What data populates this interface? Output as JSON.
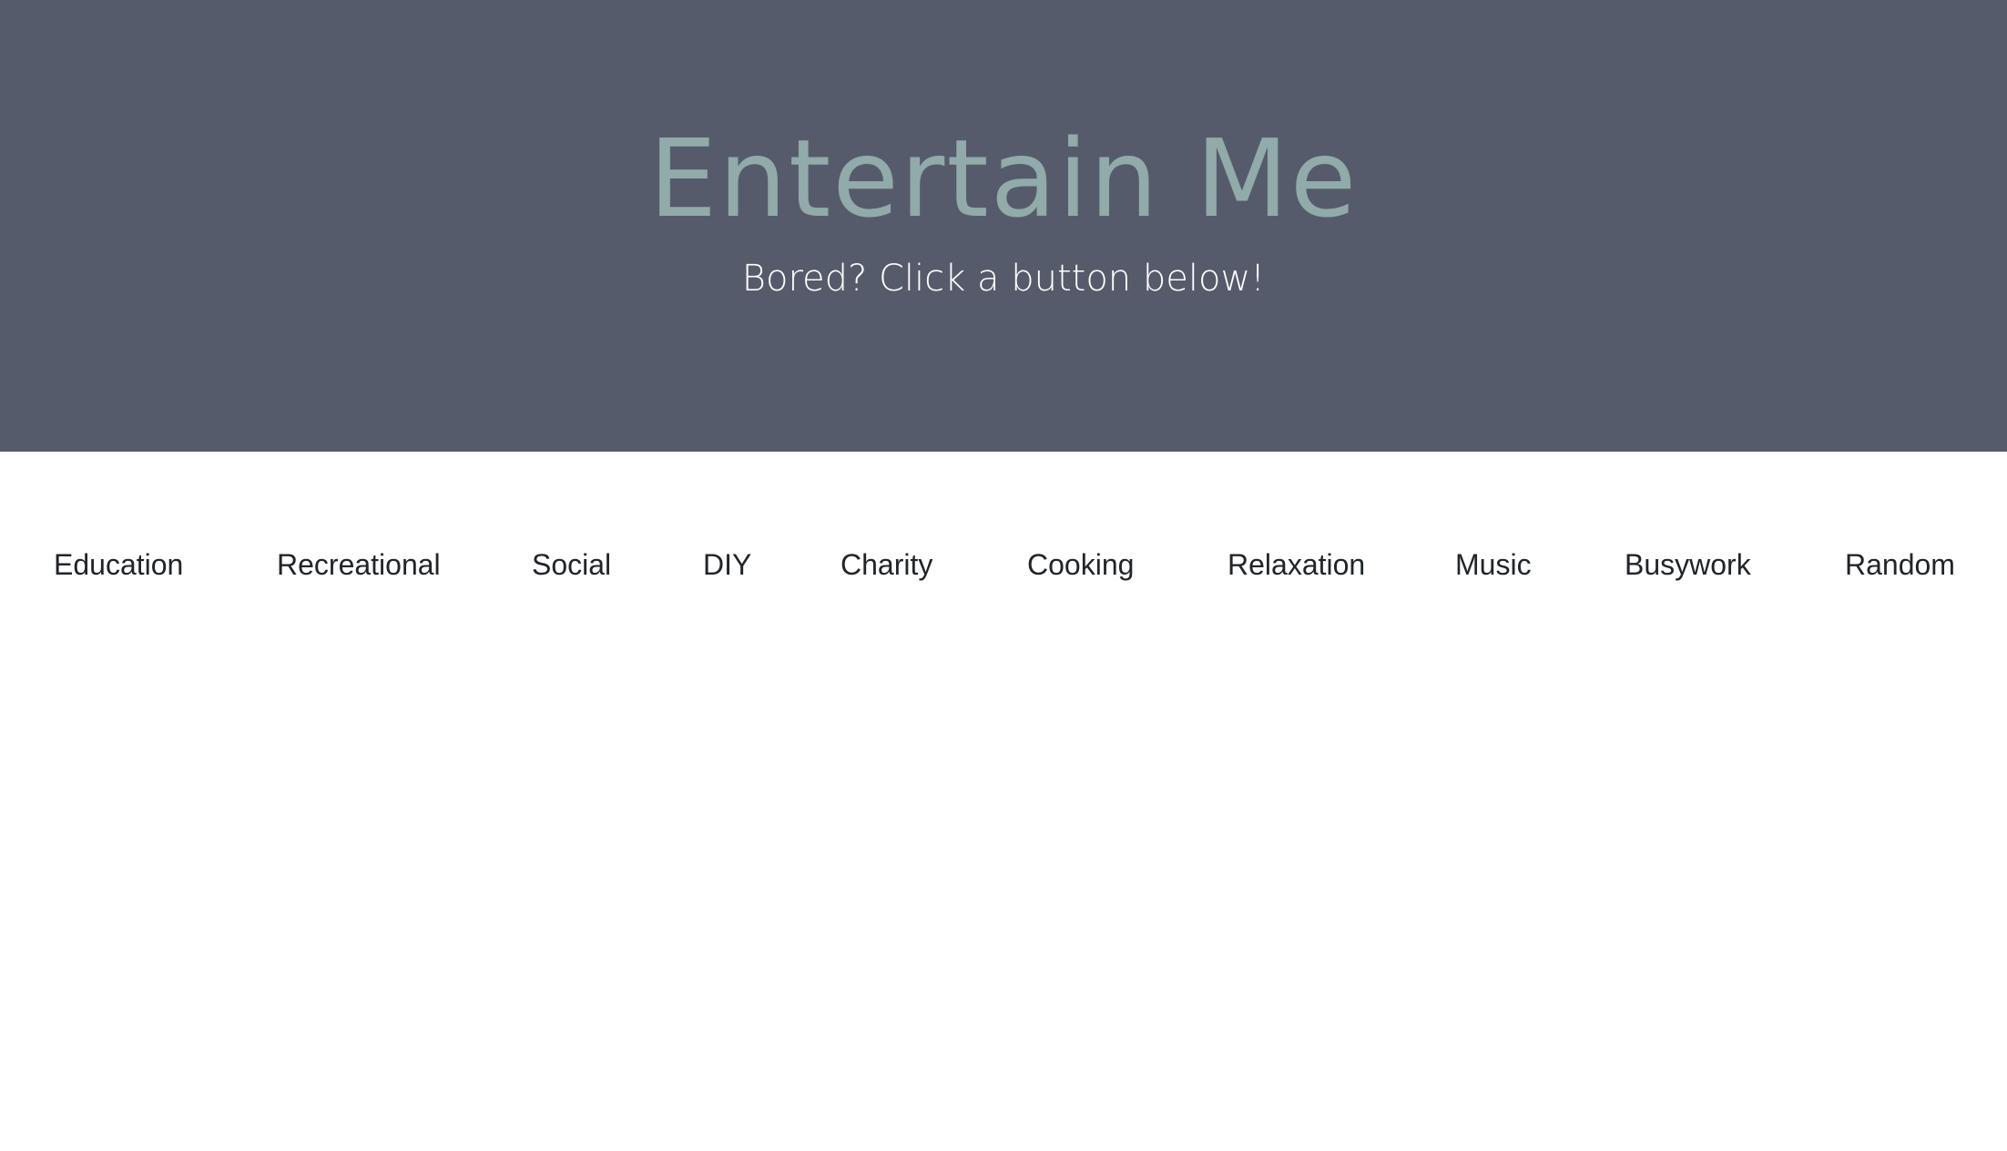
{
  "header": {
    "title": "Entertain Me",
    "subtitle": "Bored? Click a button below!"
  },
  "categories": [
    {
      "label": "Education"
    },
    {
      "label": "Recreational"
    },
    {
      "label": "Social"
    },
    {
      "label": "DIY"
    },
    {
      "label": "Charity"
    },
    {
      "label": "Cooking"
    },
    {
      "label": "Relaxation"
    },
    {
      "label": "Music"
    },
    {
      "label": "Busywork"
    },
    {
      "label": "Random"
    }
  ],
  "colors": {
    "hero_background": "#565b6b",
    "title": "#91aaaa",
    "subtitle": "#ffffff",
    "button_text": "#212529",
    "page_background": "#ffffff"
  }
}
